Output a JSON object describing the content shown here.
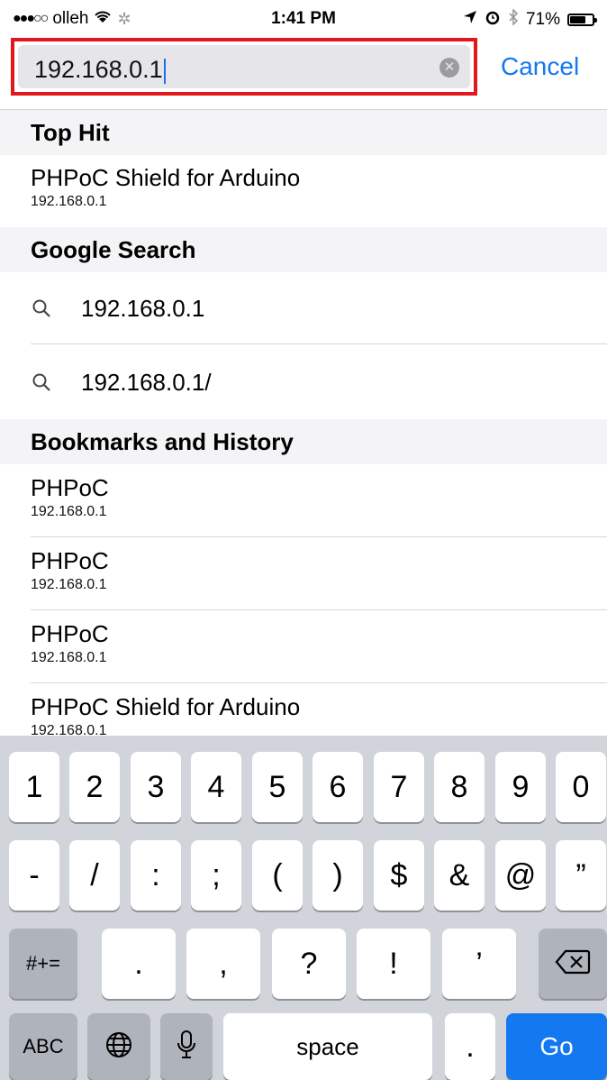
{
  "status_bar": {
    "signal_dots": "●●●○○",
    "carrier": "olleh",
    "time": "1:41 PM",
    "battery_percent": "71%",
    "battery_level": 0.71,
    "icons": [
      "wifi-icon",
      "activity-spinner-icon",
      "location-icon",
      "alarm-icon",
      "bluetooth-icon",
      "battery-icon"
    ]
  },
  "search": {
    "value": "192.168.0.1",
    "cancel_label": "Cancel",
    "highlight_color": "#e2161c"
  },
  "sections": {
    "top_hit": {
      "header": "Top Hit",
      "item": {
        "title": "PHPoC Shield for Arduino",
        "url": "192.168.0.1"
      }
    },
    "google": {
      "header": "Google Search",
      "items": [
        "192.168.0.1",
        "192.168.0.1/"
      ]
    },
    "bookmarks": {
      "header": "Bookmarks and History",
      "items": [
        {
          "title": "PHPoC",
          "url": "192.168.0.1"
        },
        {
          "title": "PHPoC",
          "url": "192.168.0.1"
        },
        {
          "title": "PHPoC",
          "url": "192.168.0.1"
        },
        {
          "title": "PHPoC Shield for Arduino",
          "url": "192.168.0.1"
        }
      ]
    }
  },
  "keyboard": {
    "row1": [
      "1",
      "2",
      "3",
      "4",
      "5",
      "6",
      "7",
      "8",
      "9",
      "0"
    ],
    "row2": [
      "-",
      "/",
      ":",
      ";",
      "(",
      ")",
      "$",
      "&",
      "@",
      "”"
    ],
    "row3": [
      ".",
      ",",
      "?",
      "!",
      "’"
    ],
    "symbols_label": "#+=",
    "abc_label": "ABC",
    "space_label": "space",
    "period_label": ".",
    "go_label": "Go",
    "accent_color": "#1478f0"
  }
}
